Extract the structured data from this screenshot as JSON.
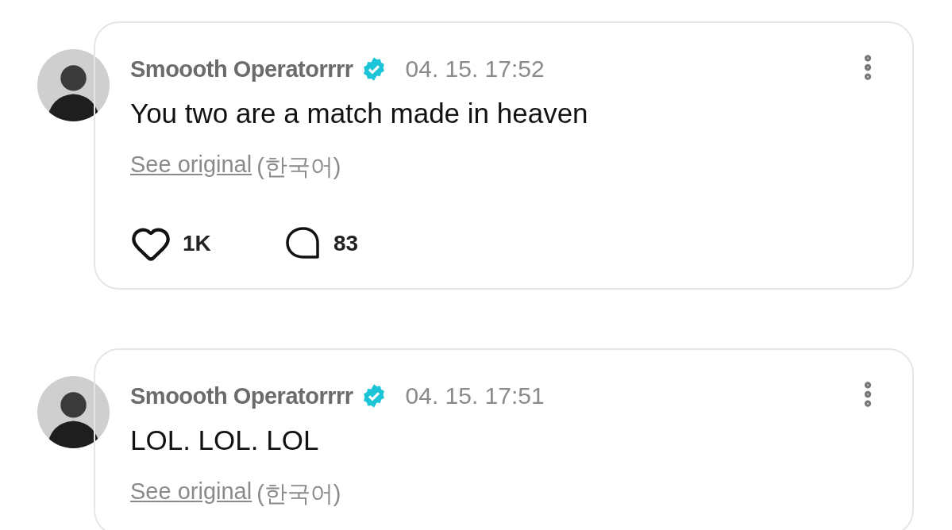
{
  "posts": [
    {
      "author": "Smoooth Operatorrrr",
      "verified": true,
      "time": "04. 15. 17:52",
      "text": "You two are a match made in heaven",
      "see_original": "See original",
      "language": "(한국어)",
      "likes": "1K",
      "comments": "83"
    },
    {
      "author": "Smoooth Operatorrrr",
      "verified": true,
      "time": "04. 15. 17:51",
      "text": "LOL. LOL. LOL",
      "see_original": "See original",
      "language": "(한국어)"
    }
  ]
}
